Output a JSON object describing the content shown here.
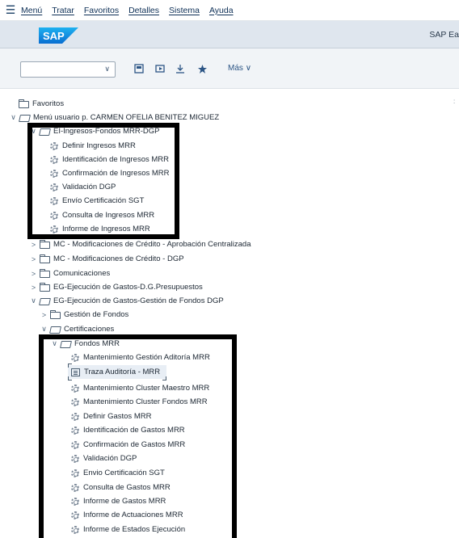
{
  "menubar": {
    "items": [
      "Menú",
      "Tratar",
      "Favoritos",
      "Detalles",
      "Sistema",
      "Ayuda"
    ]
  },
  "shell": {
    "logo_text": "SAP",
    "title": "SAP Ea"
  },
  "toolbar": {
    "command_field_value": "",
    "more_label": "Más"
  },
  "tree": {
    "favoritos": "Favoritos",
    "user_menu": "Menú usuario p. CARMEN OFELIA BENITEZ MIGUEZ",
    "ei_folder": "EI-Ingresos-Fondos MRR-DGP",
    "ei_items": [
      "Definir Ingresos MRR",
      "Identificación de Ingresos MRR",
      "Confirmación de Ingresos MRR",
      "Validación DGP",
      "Envío Certificación SGT",
      "Consulta de Ingresos MRR",
      "Informe de Ingresos MRR"
    ],
    "mc_central": "MC - Modificaciones de Crédito - Aprobación Centralizada",
    "mc_dgp": "MC - Modificaciones de Crédito - DGP",
    "comunicaciones": "Comunicaciones",
    "eg_presupuestos": "EG-Ejecución de Gastos-D.G.Presupuestos",
    "eg_gestion": "EG-Ejecución de Gastos-Gestión de Fondos DGP",
    "gestion_fondos": "Gestión de Fondos",
    "certificaciones": "Certificaciones",
    "fondos_mrr": "Fondos MRR",
    "fondos_items": [
      "Mantenimiento Gestión Aditoría MRR",
      "Traza Auditoría - MRR",
      "Mantenimiento Cluster Maestro MRR",
      "Mantenimiento Cluster Fondos MRR",
      "Definir Gastos MRR",
      "Identificación de Gastos MRR",
      "Confirmación de Gastos MRR",
      "Validación DGP",
      "Envio Certificación SGT",
      "Consulta de Gastos MRR",
      "Informe de Gastos MRR",
      "Informe de Actuaciones MRR",
      "Informe de Estados Ejecución"
    ]
  },
  "colors": {
    "shellbar": "#dfe6ee",
    "sap_blue": "#0a6ed1",
    "highlight_border": "#000000"
  },
  "icons": {
    "menu": "hamburger-icon",
    "folder": "folder-icon",
    "transaction": "gear-icon",
    "report": "report-icon"
  }
}
